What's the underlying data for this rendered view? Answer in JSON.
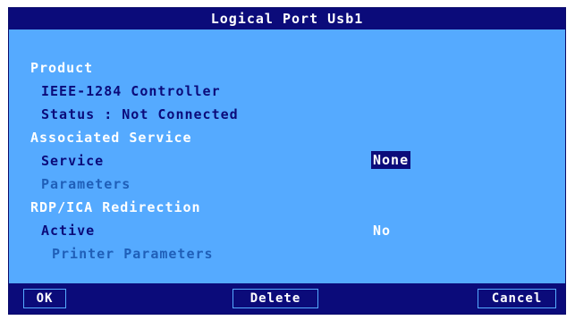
{
  "window": {
    "title": "Logical Port Usb1"
  },
  "product": {
    "section_label": "Product",
    "device_name": "IEEE-1284 Controller",
    "status_text": "Status : Not Connected"
  },
  "associated_service": {
    "section_label": "Associated Service",
    "service_label": "Service",
    "service_value": "None",
    "parameters_label": "Parameters"
  },
  "redirection": {
    "section_label": "RDP/ICA Redirection",
    "active_label": "Active",
    "active_value": "No",
    "printer_parameters_label": "Printer Parameters"
  },
  "footer": {
    "ok_label": "OK",
    "delete_label": "Delete",
    "cancel_label": "Cancel"
  },
  "colors": {
    "dialog_background": "#55aaff",
    "title_background": "#0b0b7a",
    "text_white": "#ffffff",
    "text_navy": "#0b0b7a",
    "text_disabled": "#1f5fb8"
  }
}
